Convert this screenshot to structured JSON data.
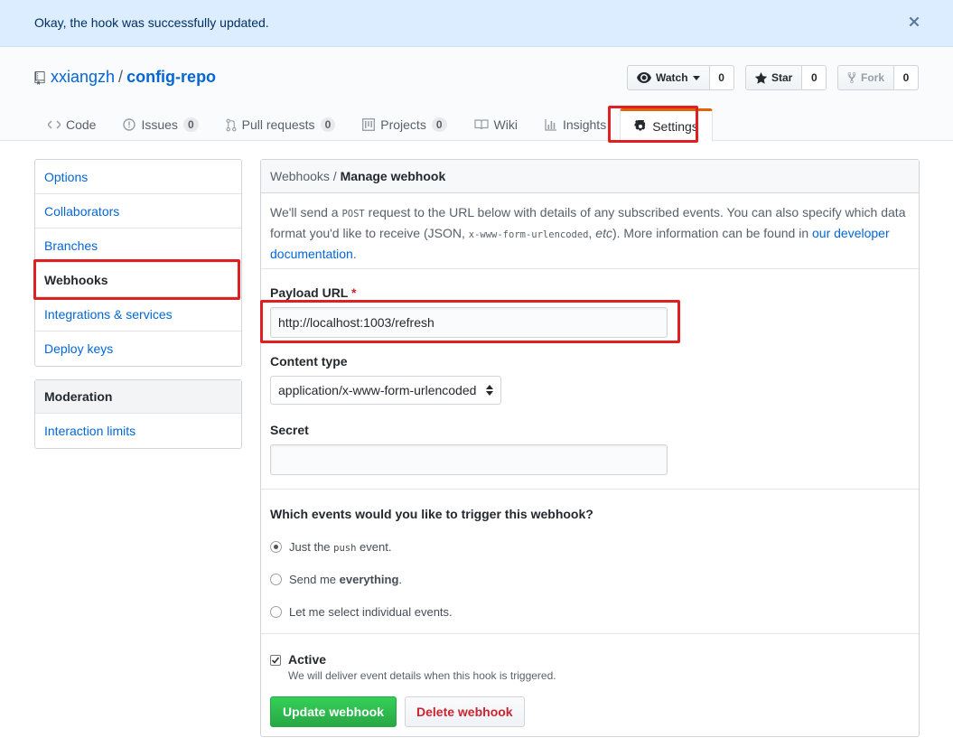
{
  "flash": {
    "message": "Okay, the hook was successfully updated."
  },
  "repo": {
    "owner": "xxiangzh",
    "separator": "/",
    "name": "config-repo"
  },
  "actions": {
    "watch_label": "Watch",
    "watch_count": "0",
    "star_label": "Star",
    "star_count": "0",
    "fork_label": "Fork",
    "fork_count": "0"
  },
  "tabs": [
    {
      "label": "Code",
      "icon": "code-icon"
    },
    {
      "label": "Issues",
      "count": "0",
      "icon": "issue-icon"
    },
    {
      "label": "Pull requests",
      "count": "0",
      "icon": "pull-request-icon"
    },
    {
      "label": "Projects",
      "count": "0",
      "icon": "project-icon"
    },
    {
      "label": "Wiki",
      "icon": "book-icon"
    },
    {
      "label": "Insights",
      "icon": "graph-icon"
    },
    {
      "label": "Settings",
      "icon": "gear-icon",
      "selected": true
    }
  ],
  "sidebar": {
    "items": [
      {
        "label": "Options"
      },
      {
        "label": "Collaborators"
      },
      {
        "label": "Branches"
      },
      {
        "label": "Webhooks",
        "selected": true
      },
      {
        "label": "Integrations & services"
      },
      {
        "label": "Deploy keys"
      }
    ],
    "moderation": {
      "heading": "Moderation",
      "items": [
        {
          "label": "Interaction limits"
        }
      ]
    }
  },
  "main": {
    "breadcrumb": "Webhooks /",
    "title": "Manage webhook",
    "intro_1": "We'll send a ",
    "intro_code_1": "POST",
    "intro_2": " request to the URL below with details of any subscribed events. You can also specify which data format you'd like to receive (JSON, ",
    "intro_code_2": "x-www-form-urlencoded",
    "intro_3": ", ",
    "intro_etc": "etc",
    "intro_4": "). More information can be found in ",
    "intro_link": "our developer documentation",
    "intro_5": ".",
    "payload_label": "Payload URL",
    "payload_required": "*",
    "payload_value": "http://localhost:1003/refresh",
    "content_type_label": "Content type",
    "content_type_value": "application/x-www-form-urlencoded",
    "secret_label": "Secret",
    "secret_value": "",
    "events_question": "Which events would you like to trigger this webhook?",
    "event_options": [
      {
        "pre": "Just the ",
        "code": "push",
        "post": " event.",
        "checked": true
      },
      {
        "pre": "Send me ",
        "bold": "everything",
        "post": ".",
        "checked": false
      },
      {
        "pre": "Let me select individual events.",
        "checked": false
      }
    ],
    "active_label": "Active",
    "active_checked": true,
    "active_note": "We will deliver event details when this hook is triggered.",
    "update_button": "Update webhook",
    "delete_button": "Delete webhook"
  },
  "colors": {
    "highlight": "#e02020",
    "link": "#0366d6",
    "green": "#28a745",
    "danger": "#cb2431",
    "flash_bg": "#dbedff"
  }
}
